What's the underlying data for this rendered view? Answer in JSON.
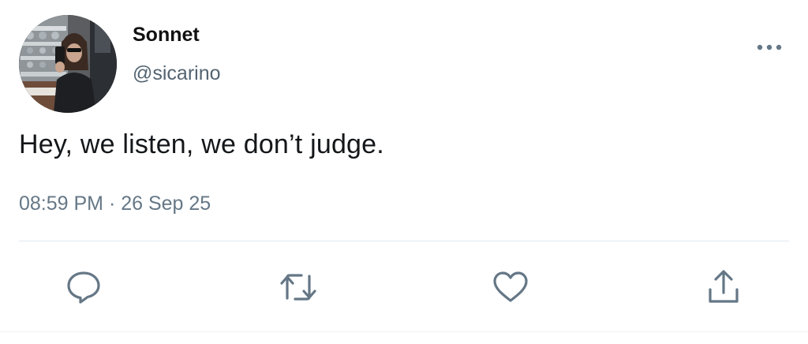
{
  "user": {
    "display_name": "Sonnet",
    "handle": "@sicarino"
  },
  "tweet": {
    "text": "Hey, we listen, we don’t judge.",
    "timestamp": "08:59 PM · 26 Sep 25"
  },
  "icons": {
    "more": "more-dots-icon",
    "reply": "reply-icon",
    "retweet": "retweet-icon",
    "like": "heart-icon",
    "share": "share-icon"
  },
  "colors": {
    "icon": "#657786",
    "text": "#14171a",
    "muted": "#657786",
    "divider": "#e1e8ed"
  }
}
